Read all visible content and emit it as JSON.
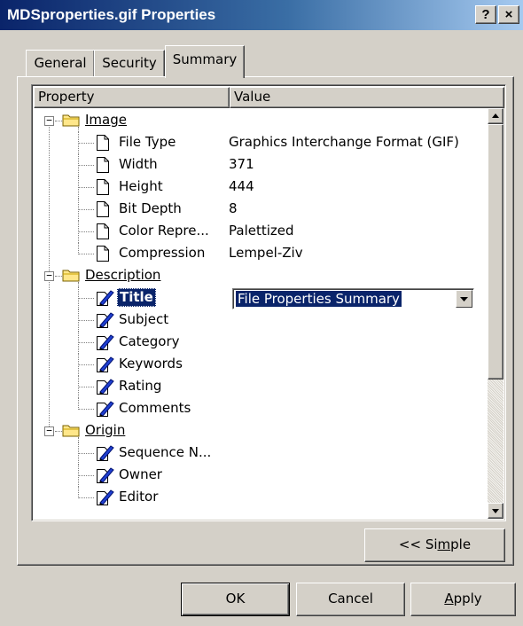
{
  "window": {
    "title": "MDSproperties.gif Properties",
    "help_button": "?",
    "close_button": "×"
  },
  "tabs": [
    {
      "label": "General",
      "active": false
    },
    {
      "label": "Security",
      "active": false
    },
    {
      "label": "Summary",
      "active": true
    }
  ],
  "list": {
    "columns": [
      "Property",
      "Value"
    ],
    "rows": [
      {
        "type": "category",
        "label": "Image",
        "value": ""
      },
      {
        "type": "item",
        "label": "File Type",
        "value": "Graphics Interchange Format (GIF)",
        "icon": "document-icon"
      },
      {
        "type": "item",
        "label": "Width",
        "value": "371",
        "icon": "document-icon"
      },
      {
        "type": "item",
        "label": "Height",
        "value": "444",
        "icon": "document-icon"
      },
      {
        "type": "item",
        "label": "Bit Depth",
        "value": "8",
        "icon": "document-icon"
      },
      {
        "type": "item",
        "label": "Color Repre...",
        "value": "Palettized",
        "icon": "document-icon"
      },
      {
        "type": "item",
        "label": "Compression",
        "value": "Lempel-Ziv",
        "icon": "document-icon"
      },
      {
        "type": "category",
        "label": "Description",
        "value": ""
      },
      {
        "type": "item",
        "label": "Title",
        "value": "File Properties Summary",
        "icon": "edit-document-icon",
        "selected": true
      },
      {
        "type": "item",
        "label": "Subject",
        "value": "",
        "icon": "edit-document-icon"
      },
      {
        "type": "item",
        "label": "Category",
        "value": "",
        "icon": "edit-document-icon"
      },
      {
        "type": "item",
        "label": "Keywords",
        "value": "",
        "icon": "edit-document-icon"
      },
      {
        "type": "item",
        "label": "Rating",
        "value": "",
        "icon": "edit-document-icon"
      },
      {
        "type": "item",
        "label": "Comments",
        "value": "",
        "icon": "edit-document-icon"
      },
      {
        "type": "category",
        "label": "Origin",
        "value": ""
      },
      {
        "type": "item",
        "label": "Sequence N...",
        "value": "",
        "icon": "edit-document-icon"
      },
      {
        "type": "item",
        "label": "Owner",
        "value": "",
        "icon": "edit-document-icon"
      },
      {
        "type": "item",
        "label": "Editor",
        "value": "",
        "icon": "edit-document-icon"
      }
    ]
  },
  "simple_button": {
    "pre": "<< Si",
    "accel": "m",
    "post": "ple"
  },
  "buttons": {
    "ok": "OK",
    "cancel": "Cancel",
    "apply": {
      "accel": "A",
      "post": "pply"
    }
  },
  "colors": {
    "title_gradient_start": "#0a246a",
    "title_gradient_end": "#a6caf0",
    "face": "#d4d0c8",
    "selection": "#0a246a"
  }
}
